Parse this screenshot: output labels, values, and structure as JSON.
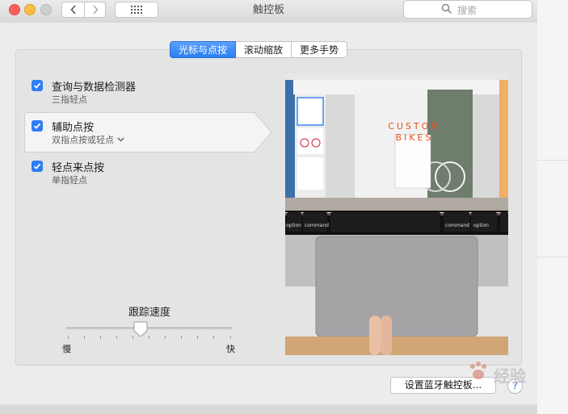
{
  "window": {
    "title": "触控板"
  },
  "search": {
    "placeholder": "搜索"
  },
  "tabs": [
    {
      "label": "光标与点按",
      "active": true
    },
    {
      "label": "滚动缩放",
      "active": false
    },
    {
      "label": "更多手势",
      "active": false
    }
  ],
  "options": [
    {
      "label": "查询与数据检测器",
      "sublabel": "三指轻点",
      "checked": true
    },
    {
      "label": "辅助点按",
      "sublabel": "双指点按或轻点",
      "checked": true,
      "selected": true
    },
    {
      "label": "轻点来点按",
      "sublabel": "单指轻点",
      "checked": true
    }
  ],
  "tracking": {
    "title": "跟踪速度",
    "min_label": "慢",
    "max_label": "快",
    "level": 0.45
  },
  "preview": {
    "banner_text": "CUSTOM BIKES",
    "keys": {
      "left_key": "option",
      "cmd_left": "command",
      "cmd_right": "command",
      "right_key": "option"
    }
  },
  "buttons": {
    "bluetooth": "设置蓝牙触控板...",
    "help": "?"
  },
  "watermark": {
    "text": "经验"
  },
  "colors": {
    "accent": "#2e7cf6",
    "banner": "#e8501c"
  }
}
